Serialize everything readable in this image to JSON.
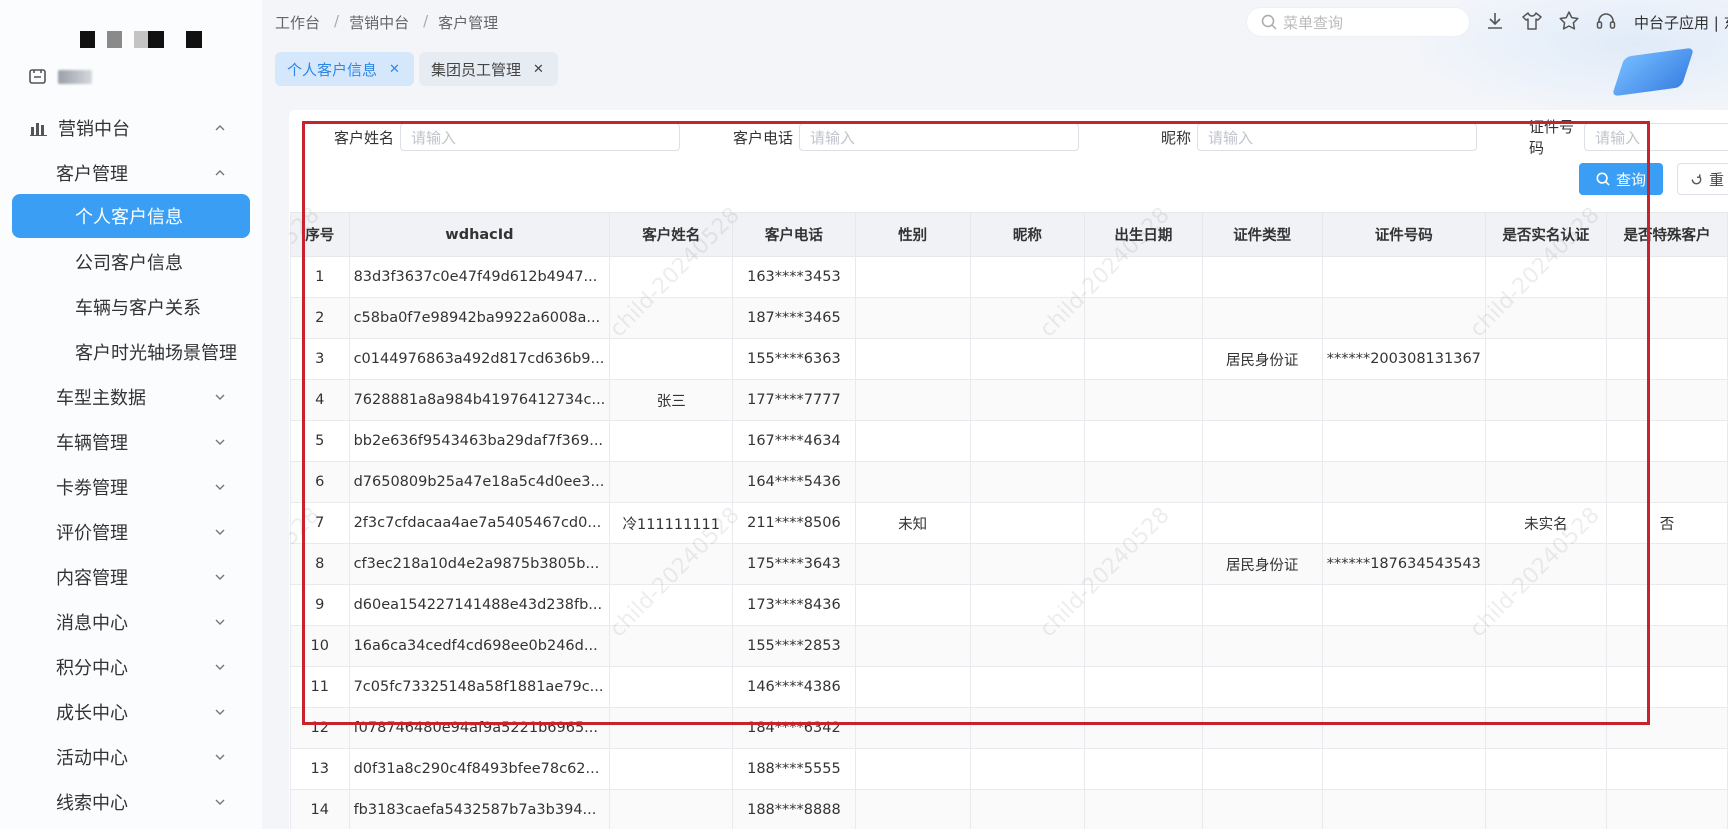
{
  "breadcrumb": [
    "工作台",
    "营销中台",
    "客户管理"
  ],
  "search": {
    "placeholder": "菜单查询"
  },
  "header": {
    "app_name": "中台子应用 | 东"
  },
  "sidebar": {
    "items": [
      {
        "label": "营销中台",
        "level": 1,
        "expanded": true
      },
      {
        "label": "客户管理",
        "level": 2,
        "expanded": true
      },
      {
        "label": "个人客户信息",
        "level": 3,
        "active": true
      },
      {
        "label": "公司客户信息",
        "level": 3
      },
      {
        "label": "车辆与客户关系",
        "level": 3
      },
      {
        "label": "客户时光轴场景管理",
        "level": 3
      },
      {
        "label": "车型主数据",
        "level": 2
      },
      {
        "label": "车辆管理",
        "level": 2
      },
      {
        "label": "卡劵管理",
        "level": 2
      },
      {
        "label": "评价管理",
        "level": 2
      },
      {
        "label": "内容管理",
        "level": 2
      },
      {
        "label": "消息中心",
        "level": 2
      },
      {
        "label": "积分中心",
        "level": 2
      },
      {
        "label": "成长中心",
        "level": 2
      },
      {
        "label": "活动中心",
        "level": 2
      },
      {
        "label": "线索中心",
        "level": 2
      }
    ]
  },
  "tabs": [
    {
      "label": "个人客户信息",
      "active": true
    },
    {
      "label": "集团员工管理",
      "active": false
    }
  ],
  "filters": {
    "name_label": "客户姓名",
    "phone_label": "客户电话",
    "nickname_label": "昵称",
    "idno_label": "证件号码",
    "placeholder": "请输入",
    "query_label": "查询",
    "reset_label": "重"
  },
  "table": {
    "columns": [
      "序号",
      "wdhacId",
      "客户姓名",
      "客户电话",
      "性别",
      "昵称",
      "出生日期",
      "证件类型",
      "证件号码",
      "是否实名认证",
      "是否特殊客户"
    ],
    "rows": [
      [
        "1",
        "83d3f3637c0e47f49d612b4947...",
        "",
        "163****3453",
        "",
        "",
        "",
        "",
        "",
        "",
        ""
      ],
      [
        "2",
        "c58ba0f7e98942ba9922a6008a...",
        "",
        "187****3465",
        "",
        "",
        "",
        "",
        "",
        "",
        ""
      ],
      [
        "3",
        "c0144976863a492d817cd636b9...",
        "",
        "155****6363",
        "",
        "",
        "",
        "居民身份证",
        "******200308131367",
        "",
        ""
      ],
      [
        "4",
        "7628881a8a984b41976412734c...",
        "张三",
        "177****7777",
        "",
        "",
        "",
        "",
        "",
        "",
        ""
      ],
      [
        "5",
        "bb2e636f9543463ba29daf7f369...",
        "",
        "167****4634",
        "",
        "",
        "",
        "",
        "",
        "",
        ""
      ],
      [
        "6",
        "d7650809b25a47e18a5c4d0ee3...",
        "",
        "164****5436",
        "",
        "",
        "",
        "",
        "",
        "",
        ""
      ],
      [
        "7",
        "2f3c7cfdacaa4ae7a5405467cd0...",
        "冷111111111",
        "211****8506",
        "未知",
        "",
        "",
        "",
        "",
        "未实名",
        "否"
      ],
      [
        "8",
        "cf3ec218a10d4e2a9875b3805b...",
        "",
        "175****3643",
        "",
        "",
        "",
        "居民身份证",
        "******187634543543",
        "",
        ""
      ],
      [
        "9",
        "d60ea154227141488e43d238fb...",
        "",
        "173****8436",
        "",
        "",
        "",
        "",
        "",
        "",
        ""
      ],
      [
        "10",
        "16a6ca34cedf4cd698ee0b246d...",
        "",
        "155****2853",
        "",
        "",
        "",
        "",
        "",
        "",
        ""
      ],
      [
        "11",
        "7c05fc73325148a58f1881ae79c...",
        "",
        "146****4386",
        "",
        "",
        "",
        "",
        "",
        "",
        ""
      ],
      [
        "12",
        "f078746480e94af9a5221b6965...",
        "",
        "184****6342",
        "",
        "",
        "",
        "",
        "",
        "",
        ""
      ],
      [
        "13",
        "d0f31a8c290c4f8493bfee78c62...",
        "",
        "188****5555",
        "",
        "",
        "",
        "",
        "",
        "",
        ""
      ],
      [
        "14",
        "fb3183caefa5432587b7a3b394...",
        "",
        "188****8888",
        "",
        "",
        "",
        "",
        "",
        "",
        ""
      ]
    ]
  },
  "watermark": "child-20240528",
  "colors": {
    "accent": "#3a9ef5",
    "highlight_box": "#c8232c"
  }
}
